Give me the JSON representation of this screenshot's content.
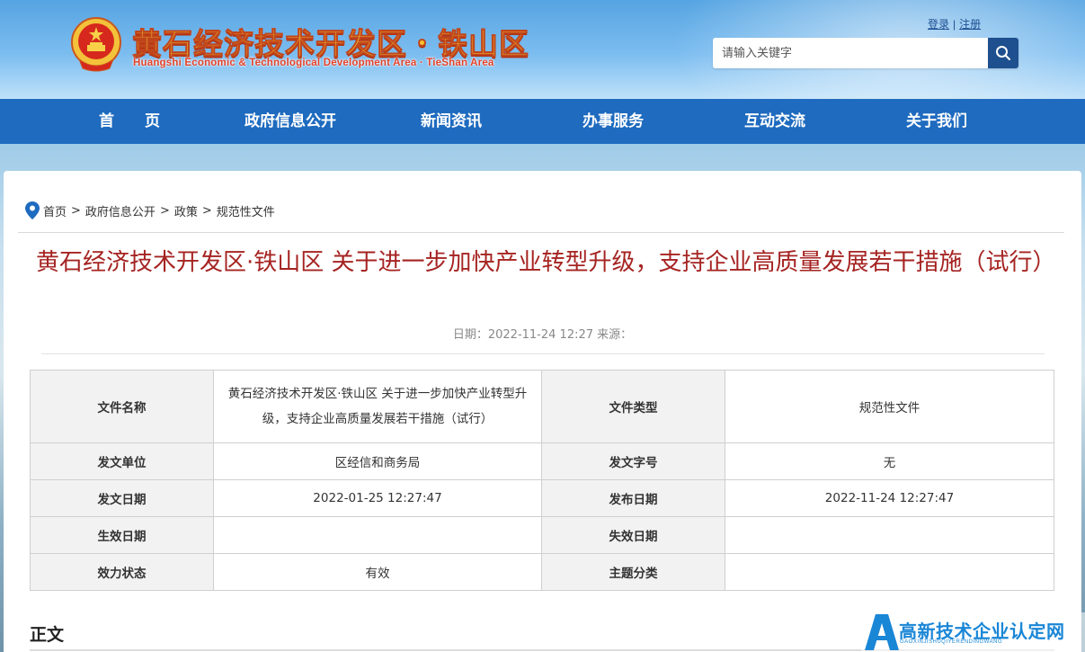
{
  "header": {
    "site_title": "黄石经济技术开发区・铁山区",
    "site_subtitle": "Huangshi Economic & Technological Development Area · TieShan Area",
    "auth": {
      "login": "登录",
      "separator": "|",
      "register": "注册"
    },
    "search": {
      "placeholder": "请输入关键字",
      "icon": "search-icon"
    }
  },
  "nav": {
    "items": [
      {
        "label": "首　　页"
      },
      {
        "label": "政府信息公开"
      },
      {
        "label": "新闻资讯"
      },
      {
        "label": "办事服务"
      },
      {
        "label": "互动交流"
      },
      {
        "label": "关于我们"
      }
    ]
  },
  "breadcrumb": {
    "icon": "location-pin-icon",
    "items": [
      "首页",
      "政府信息公开",
      "政策",
      "规范性文件"
    ],
    "separator": ">"
  },
  "article": {
    "title": "黄石经济技术开发区·铁山区 关于进一步加快产业转型升级，支持企业高质量发展若干措施（试行）",
    "meta": "日期：2022-11-24 12:27 来源："
  },
  "info_table": {
    "rows": [
      {
        "k1": "文件名称",
        "v1": "黄石经济技术开发区·铁山区 关于进一步加快产业转型升级，支持企业高质量发展若干措施（试行）",
        "k2": "文件类型",
        "v2": "规范性文件"
      },
      {
        "k1": "发文单位",
        "v1": "区经信和商务局",
        "k2": "发文字号",
        "v2": "无"
      },
      {
        "k1": "发文日期",
        "v1": "2022-01-25 12:27:47",
        "k2": "发布日期",
        "v2": "2022-11-24 12:27:47"
      },
      {
        "k1": "生效日期",
        "v1": "",
        "k2": "失效日期",
        "v2": ""
      },
      {
        "k1": "效力状态",
        "v1": "有效",
        "k2": "主题分类",
        "v2": ""
      }
    ]
  },
  "body": {
    "heading": "正文"
  },
  "watermark": {
    "text": "高新技术企业认定网",
    "sub": "GAOXINJISHUQIYERENDINGWANG"
  },
  "colors": {
    "nav_bg": "#1e6bbf",
    "title_red": "#a52422",
    "search_btn": "#1e4f8e",
    "watermark_blue": "#1a86d6"
  }
}
